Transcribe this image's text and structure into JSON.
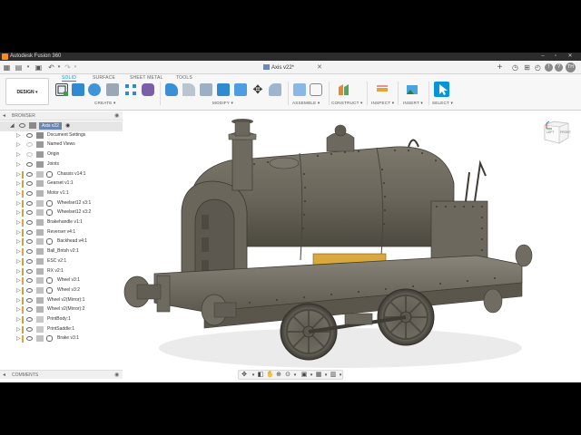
{
  "window": {
    "title": "Autodesk Fusion 360"
  },
  "document_tab": {
    "label": "Axis v22*"
  },
  "user": {
    "initials": "TH"
  },
  "ribbon": {
    "workspace": "DESIGN ▾",
    "tabs": [
      {
        "label": "SOLID",
        "active": true
      },
      {
        "label": "SURFACE",
        "active": false
      },
      {
        "label": "SHEET METAL",
        "active": false
      },
      {
        "label": "TOOLS",
        "active": false
      }
    ],
    "groups": [
      {
        "label": "CREATE ▾"
      },
      {
        "label": "MODIFY ▾"
      },
      {
        "label": "ASSEMBLE ▾"
      },
      {
        "label": "CONSTRUCT ▾"
      },
      {
        "label": "INSPECT ▾"
      },
      {
        "label": "INSERT ▾"
      },
      {
        "label": "SELECT ▾"
      }
    ]
  },
  "browser": {
    "header": "BROWSER",
    "root": "Axis v22",
    "items": [
      {
        "label": "Document Settings",
        "type": "settings",
        "indent": 1
      },
      {
        "label": "Named Views",
        "type": "folder",
        "indent": 1
      },
      {
        "label": "Origin",
        "type": "folder",
        "indent": 1
      },
      {
        "label": "Joints",
        "type": "folder",
        "indent": 1
      },
      {
        "label": "Chassis v14:1",
        "type": "link",
        "indent": 1
      },
      {
        "label": "Gearset v1:1",
        "type": "component",
        "indent": 1
      },
      {
        "label": "Motor v1:1",
        "type": "component",
        "indent": 1
      },
      {
        "label": "Wheelset12 v3:1",
        "type": "link",
        "indent": 1
      },
      {
        "label": "Wheelset12 v3:2",
        "type": "link",
        "indent": 1
      },
      {
        "label": "Brakehandle v1:1",
        "type": "component",
        "indent": 1
      },
      {
        "label": "Reverser v4:1",
        "type": "component",
        "indent": 1
      },
      {
        "label": "Backhead v4:1",
        "type": "link",
        "indent": 1
      },
      {
        "label": "Ball_Bntsh v2:1",
        "type": "component",
        "indent": 1
      },
      {
        "label": "ESC v2:1",
        "type": "component",
        "indent": 1
      },
      {
        "label": "RX v2:1",
        "type": "component",
        "indent": 1
      },
      {
        "label": "Wheel v3:1",
        "type": "link",
        "indent": 1
      },
      {
        "label": "Wheel v3:2",
        "type": "link",
        "indent": 1
      },
      {
        "label": "Wheel v2(Mirror):1",
        "type": "component",
        "indent": 1
      },
      {
        "label": "Wheel v2(Mirror):2",
        "type": "component",
        "indent": 1
      },
      {
        "label": "PrintBody:1",
        "type": "body",
        "indent": 1
      },
      {
        "label": "PrintSaddle:1",
        "type": "body",
        "indent": 1
      },
      {
        "label": "Brake v3:1",
        "type": "link",
        "indent": 1
      }
    ]
  },
  "comments": {
    "header": "COMMENTS"
  },
  "viewcube": {
    "left_label": "LEFT",
    "front_label": "FRONT"
  },
  "colors": {
    "accent": "#0696d7",
    "title_bar": "#2b2b2b",
    "model_body": "#6e6a5f",
    "root_highlight": "#6b86b2"
  }
}
